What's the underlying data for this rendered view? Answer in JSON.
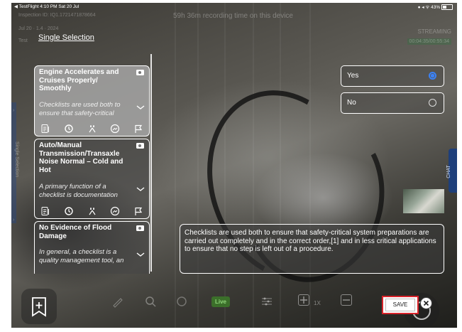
{
  "status_bar": {
    "left": "◀ TestFlight  4:10 PM  Sat 20 Jul",
    "right": "● ◂ ᯤ 43%"
  },
  "faint": {
    "inspection_id": "Inspection ID: IQ1.1721471878664",
    "recording": "59h 36m recording time on this device",
    "streaming": "STREAMING",
    "timer": "00:04:35/00:55:34",
    "date_line": "Jul 20 · 1.4 · 2024",
    "test": "Test"
  },
  "page_title": "Single Selection",
  "checklist": [
    {
      "title": "Engine Accelerates and Cruises Properly/ Smoothly",
      "desc": "Checklists are used both to ensure that safety-critical",
      "selected": true
    },
    {
      "title": "Auto/Manual Transmission/Transaxle Noise Normal – Cold and Hot",
      "desc": "A primary function of a checklist is documentation",
      "selected": false
    },
    {
      "title": "No Evidence of Flood Damage",
      "desc": "In general, a checklist is a quality management tool, an",
      "selected": false
    }
  ],
  "options": [
    {
      "label": "Yes",
      "selected": true
    },
    {
      "label": "No",
      "selected": false
    }
  ],
  "notes_text": "Checklists are used both to ensure that safety-critical system preparations are carried out completely and in the correct order,[1] and in less critical applications to ensure that no step is left out of a procedure.",
  "side_tab_label": "Single Selection",
  "chat_label": "CHAT",
  "bottom": {
    "live": "Live",
    "zoom": "1X",
    "save": "SAVE"
  },
  "colors": {
    "accent": "#3b82f6",
    "save_outline": "#d8232a",
    "live_bg": "#3b6f2a"
  }
}
